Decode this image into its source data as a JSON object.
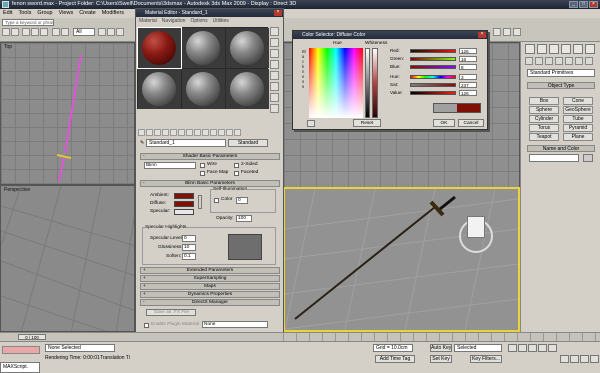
{
  "app": {
    "title": "fenon sword.max     -     Project Folder: C:\\Users\\Swell\\Documents\\3dsmax     -     Autodesk 3ds Max  2009     -     Display : Direct 3D"
  },
  "menu": [
    "Edit",
    "Tools",
    "Group",
    "Views",
    "Create",
    "Modifiers"
  ],
  "toolbar": {
    "search_placeholder": "Type a keyword or phrase",
    "view_dropdown": "All"
  },
  "viewports": {
    "top_label": "Top",
    "left_label": "Perspective"
  },
  "material_editor": {
    "title": "Material Editor - Standard_1",
    "menu": [
      "Material",
      "Navigation",
      "Options",
      "Utilities"
    ],
    "material_name": "Standard_1",
    "material_type": "Standard",
    "rollouts": {
      "shader_basic": "Shader Basic Parameters",
      "blinn_basic": "Blinn Basic Parameters",
      "extended": "Extended Parameters",
      "supersampling": "SuperSampling",
      "maps": "Maps",
      "dynamics": "Dynamics Properties",
      "directx": "DirectX Manager",
      "mental_ray": "mental ray Connection"
    },
    "shader": {
      "type": "Blinn",
      "wire": "Wire",
      "two_sided": "2-Sided",
      "face_map": "Face Map",
      "faceted": "Faceted"
    },
    "blinn": {
      "ambient": "Ambient:",
      "diffuse": "Diffuse:",
      "specular": "Specular:",
      "self_illum": "Self-Illumination",
      "color": "Color",
      "color_value": "0",
      "opacity": "Opacity:",
      "opacity_value": "100",
      "spec_highlights": "Specular Highlights",
      "spec_level": "Specular Level:",
      "spec_level_value": "0",
      "glossiness": "Glossiness:",
      "glossiness_value": "10",
      "soften": "Soften:",
      "soften_value": "0.1"
    },
    "directx": {
      "save_fx": "Save as .FX File",
      "enable_plugin": "Enable Plugin Material",
      "plugin_value": "None"
    }
  },
  "color_selector": {
    "title": "Color Selector: Diffuse Color",
    "hue_label": "Hue",
    "whiteness_label": "Whiteness",
    "blackness_label": "Blackness",
    "channels": [
      {
        "label": "Red:",
        "value": "126"
      },
      {
        "label": "Green:",
        "value": "16"
      },
      {
        "label": "Blue:",
        "value": "8"
      },
      {
        "label": "Hue:",
        "value": "3"
      },
      {
        "label": "Sat:",
        "value": "237"
      },
      {
        "label": "Value:",
        "value": "126"
      }
    ],
    "reset": "Reset",
    "ok": "OK",
    "cancel": "Cancel",
    "new_color": "#7e1008",
    "old_color": "#a0a0a0"
  },
  "command_panel": {
    "dropdown": "Standard Primitives",
    "object_type": "Object Type",
    "autogrid": "AutoGrid",
    "buttons": [
      "Box",
      "Cone",
      "Sphere",
      "GeoSphere",
      "Cylinder",
      "Tube",
      "Torus",
      "Pyramid",
      "Teapot",
      "Plane"
    ],
    "name_color": "Name and Color"
  },
  "status": {
    "frame": "0 / 100",
    "none_selected": "None Selected",
    "render_time": "Rendering Time: 0:00:01",
    "translation": "Translation Ti",
    "grid": "Grid = 10.0cm",
    "auto_key": "Auto Key",
    "selected": "Selected",
    "set_key": "Set Key",
    "key_filters": "Key Filters...",
    "add_time_tag": "Add Time Tag",
    "maxscript": "MAXScript."
  }
}
